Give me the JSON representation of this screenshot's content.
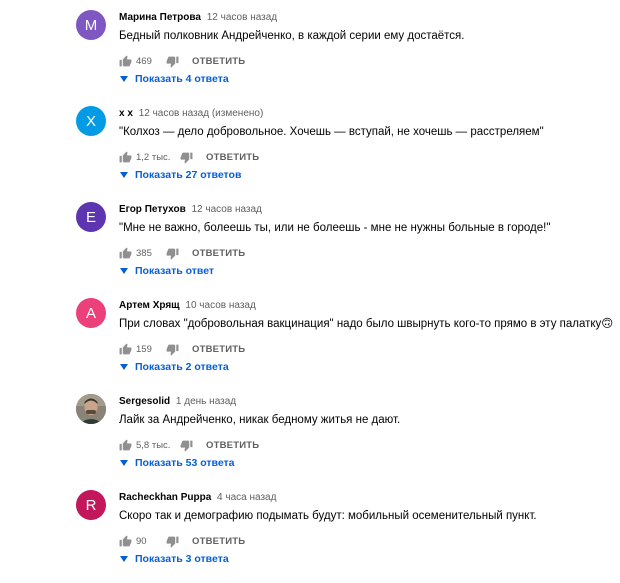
{
  "thread": {
    "comments": [
      {
        "author": "Марина Петрова",
        "time": "12 часов назад",
        "text": "Бедный полковник Андрейченко, в каждой серии ему достаётся.",
        "likes": "469",
        "reply_label": "ОТВЕТИТЬ",
        "show_replies": "Показать 4 ответа",
        "avatar_letter": "М",
        "avatar_color": "#7e57c2"
      },
      {
        "author": "x x",
        "time": "12 часов назад (изменено)",
        "text": "\"Колхоз — дело добровольное. Хочешь — вступай, не хочешь — расстреляем\"",
        "likes": "1,2 тыс.",
        "reply_label": "ОТВЕТИТЬ",
        "show_replies": "Показать 27 ответов",
        "avatar_letter": "X",
        "avatar_color": "#039be5"
      },
      {
        "author": "Егор Петухов",
        "time": "12 часов назад",
        "text": "\"Мне не важно, болеешь ты, или не болеешь - мне не нужны больные в городе!\"",
        "likes": "385",
        "reply_label": "ОТВЕТИТЬ",
        "show_replies": "Показать ответ",
        "avatar_letter": "Е",
        "avatar_color": "#5e35b1"
      },
      {
        "author": "Артем Хрящ",
        "time": "10 часов назад",
        "text": "При словах \"добровольная вакцинация\" надо было швырнуть кого-то прямо в эту палатку",
        "text_emoji": "🙃",
        "likes": "159",
        "reply_label": "ОТВЕТИТЬ",
        "show_replies": "Показать 2 ответа",
        "avatar_letter": "А",
        "avatar_color": "#ec407a"
      },
      {
        "author": "Sergesolid",
        "time": "1 день назад",
        "text": "Лайк за Андрейченко, никак бедному житья не дают.",
        "likes": "5,8 тыс.",
        "reply_label": "ОТВЕТИТЬ",
        "show_replies": "Показать 53 ответа",
        "avatar_color": "#6d6a63"
      },
      {
        "author": "Racheckhan Puppa",
        "time": "4 часа назад",
        "text": "Скоро так и демографию подымать будут: мобильный осеменительный пункт.",
        "likes": "90",
        "reply_label": "ОТВЕТИТЬ",
        "show_replies": "Показать 3 ответа",
        "avatar_letter": "R",
        "avatar_color": "#c2185b"
      }
    ]
  },
  "icons": {
    "like": "thumb-up-icon",
    "dislike": "thumb-down-icon",
    "expand": "chevron-down-icon"
  },
  "colors": {
    "link_blue": "#065fd4",
    "meta_gray": "#606060",
    "icon_gray": "#909090"
  }
}
